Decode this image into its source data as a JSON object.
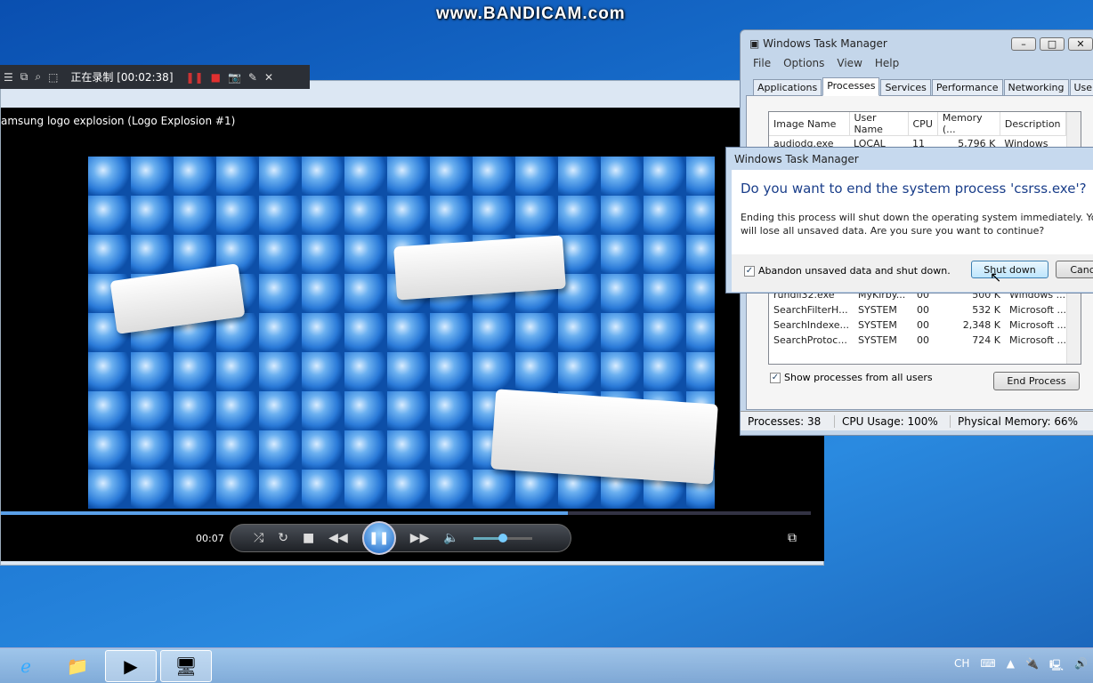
{
  "watermark": "www.BANDICAM.com",
  "bandicam": {
    "status": "正在录制 [00:02:38]",
    "icons": [
      "menu-icon",
      "window-icon",
      "region-icon",
      "fullscreen-icon",
      "pause-icon",
      "stop-icon",
      "camera-icon",
      "pencil-icon",
      "close-icon"
    ],
    "record_color": "#e03030"
  },
  "player": {
    "title": "amsung logo explosion (Logo Explosion #1)",
    "time": "00:07",
    "progress_percent": 70,
    "volume_percent": 50
  },
  "task_manager": {
    "title": "Windows Task Manager",
    "menu": [
      "File",
      "Options",
      "View",
      "Help"
    ],
    "tabs": [
      "Applications",
      "Processes",
      "Services",
      "Performance",
      "Networking",
      "Users"
    ],
    "active_tab": "Processes",
    "columns": [
      "Image Name",
      "User Name",
      "CPU",
      "Memory (...",
      "Description"
    ],
    "rows_top": [
      [
        "audiodg.exe",
        "LOCAL",
        "11",
        "5,796 K",
        "Windows"
      ]
    ],
    "rows": [
      [
        "rundll32.exe",
        "MyKirby...",
        "00",
        "500 K",
        "Windows ..."
      ],
      [
        "SearchFilterH...",
        "SYSTEM",
        "00",
        "532 K",
        "Microsoft ..."
      ],
      [
        "SearchIndexe...",
        "SYSTEM",
        "00",
        "2,348 K",
        "Microsoft ..."
      ],
      [
        "SearchProtoc...",
        "SYSTEM",
        "00",
        "724 K",
        "Microsoft ..."
      ]
    ],
    "show_all_label": "Show processes from all users",
    "end_process": "End Process",
    "status": {
      "processes": "Processes: 38",
      "cpu": "CPU Usage: 100%",
      "memory": "Physical Memory: 66%"
    }
  },
  "dialog": {
    "title": "Windows Task Manager",
    "question": "Do you want to end the system process 'csrss.exe'?",
    "message": "Ending this process will shut down the operating system immediately.  You will lose all unsaved data.  Are you sure you want to continue?",
    "checkbox": "Abandon unsaved data and shut down.",
    "shutdown": "Shut down",
    "cancel": "Cancel"
  },
  "taskbar": {
    "lang": "CH"
  }
}
